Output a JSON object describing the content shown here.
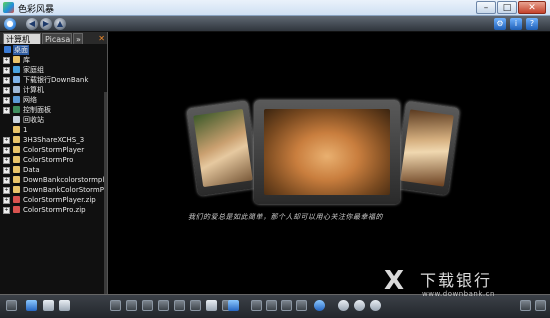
{
  "window": {
    "title": "色彩风暴"
  },
  "sidebar": {
    "tabs": [
      {
        "label": "计算机"
      },
      {
        "label": "Picasa"
      },
      {
        "label": "»"
      }
    ],
    "tab_close": "✕",
    "tree": [
      {
        "label": "桌面",
        "expander": ""
      },
      {
        "label": "库",
        "expander": "+"
      },
      {
        "label": "家庭组",
        "expander": "+"
      },
      {
        "label": "下载银行DownBank",
        "expander": "+"
      },
      {
        "label": "计算机",
        "expander": "+"
      },
      {
        "label": "网络",
        "expander": "+"
      },
      {
        "label": "控制面板",
        "expander": "+"
      },
      {
        "label": "回收站",
        "expander": ""
      },
      {
        "label": "1",
        "expander": ""
      },
      {
        "label": "3H3ShareXCHS_3",
        "expander": "+"
      },
      {
        "label": "ColorStormPlayer",
        "expander": "+"
      },
      {
        "label": "ColorStormPro",
        "expander": "+"
      },
      {
        "label": "Data",
        "expander": "+"
      },
      {
        "label": "DownBankcolorstormplaye",
        "expander": "+"
      },
      {
        "label": "DownBankColorStormPro",
        "expander": "+"
      },
      {
        "label": "ColorStormPlayer.zip",
        "expander": "+"
      },
      {
        "label": "ColorStormPro.zip",
        "expander": "+"
      }
    ]
  },
  "viewer": {
    "caption": "我们的爱总是如此简单，那个人却可以用心关注你最幸福的"
  },
  "watermark": {
    "logo_glyph": "X",
    "brand": "下载银行",
    "url": "www.downbank.cn"
  },
  "icons": [
    "app-icon",
    "back-icon",
    "forward-icon",
    "up-icon",
    "home-icon",
    "folder-icon",
    "play-icon",
    "zoom-in-icon",
    "zoom-out-icon"
  ]
}
